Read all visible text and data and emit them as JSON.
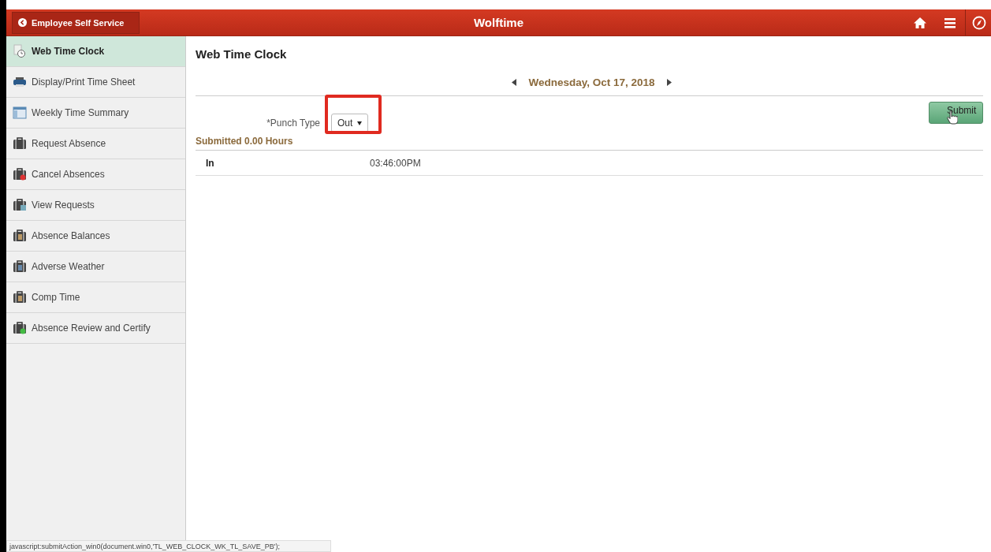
{
  "header": {
    "back_button": "Employee Self Service",
    "title": "Wolftime"
  },
  "sidebar": {
    "items": [
      {
        "label": "Web Time Clock",
        "selected": true
      },
      {
        "label": "Display/Print Time Sheet",
        "selected": false
      },
      {
        "label": "Weekly Time Summary",
        "selected": false
      },
      {
        "label": "Request Absence",
        "selected": false
      },
      {
        "label": "Cancel Absences",
        "selected": false
      },
      {
        "label": "View Requests",
        "selected": false
      },
      {
        "label": "Absence Balances",
        "selected": false
      },
      {
        "label": "Adverse Weather",
        "selected": false
      },
      {
        "label": "Comp Time",
        "selected": false
      },
      {
        "label": "Absence Review and Certify",
        "selected": false
      }
    ]
  },
  "page": {
    "title": "Web Time Clock",
    "date_nav": {
      "date": "Wednesday, Oct 17, 2018"
    },
    "submit_button": "Submit",
    "punch_type": {
      "label": "*Punch Type",
      "value": "Out"
    },
    "submitted": "Submitted 0.00 Hours",
    "punches": [
      {
        "type": "In",
        "time": "03:46:00PM"
      }
    ]
  },
  "status_bar": "javascript:submitAction_win0(document.win0,'TL_WEB_CLOCK_WK_TL_SAVE_PB');"
}
